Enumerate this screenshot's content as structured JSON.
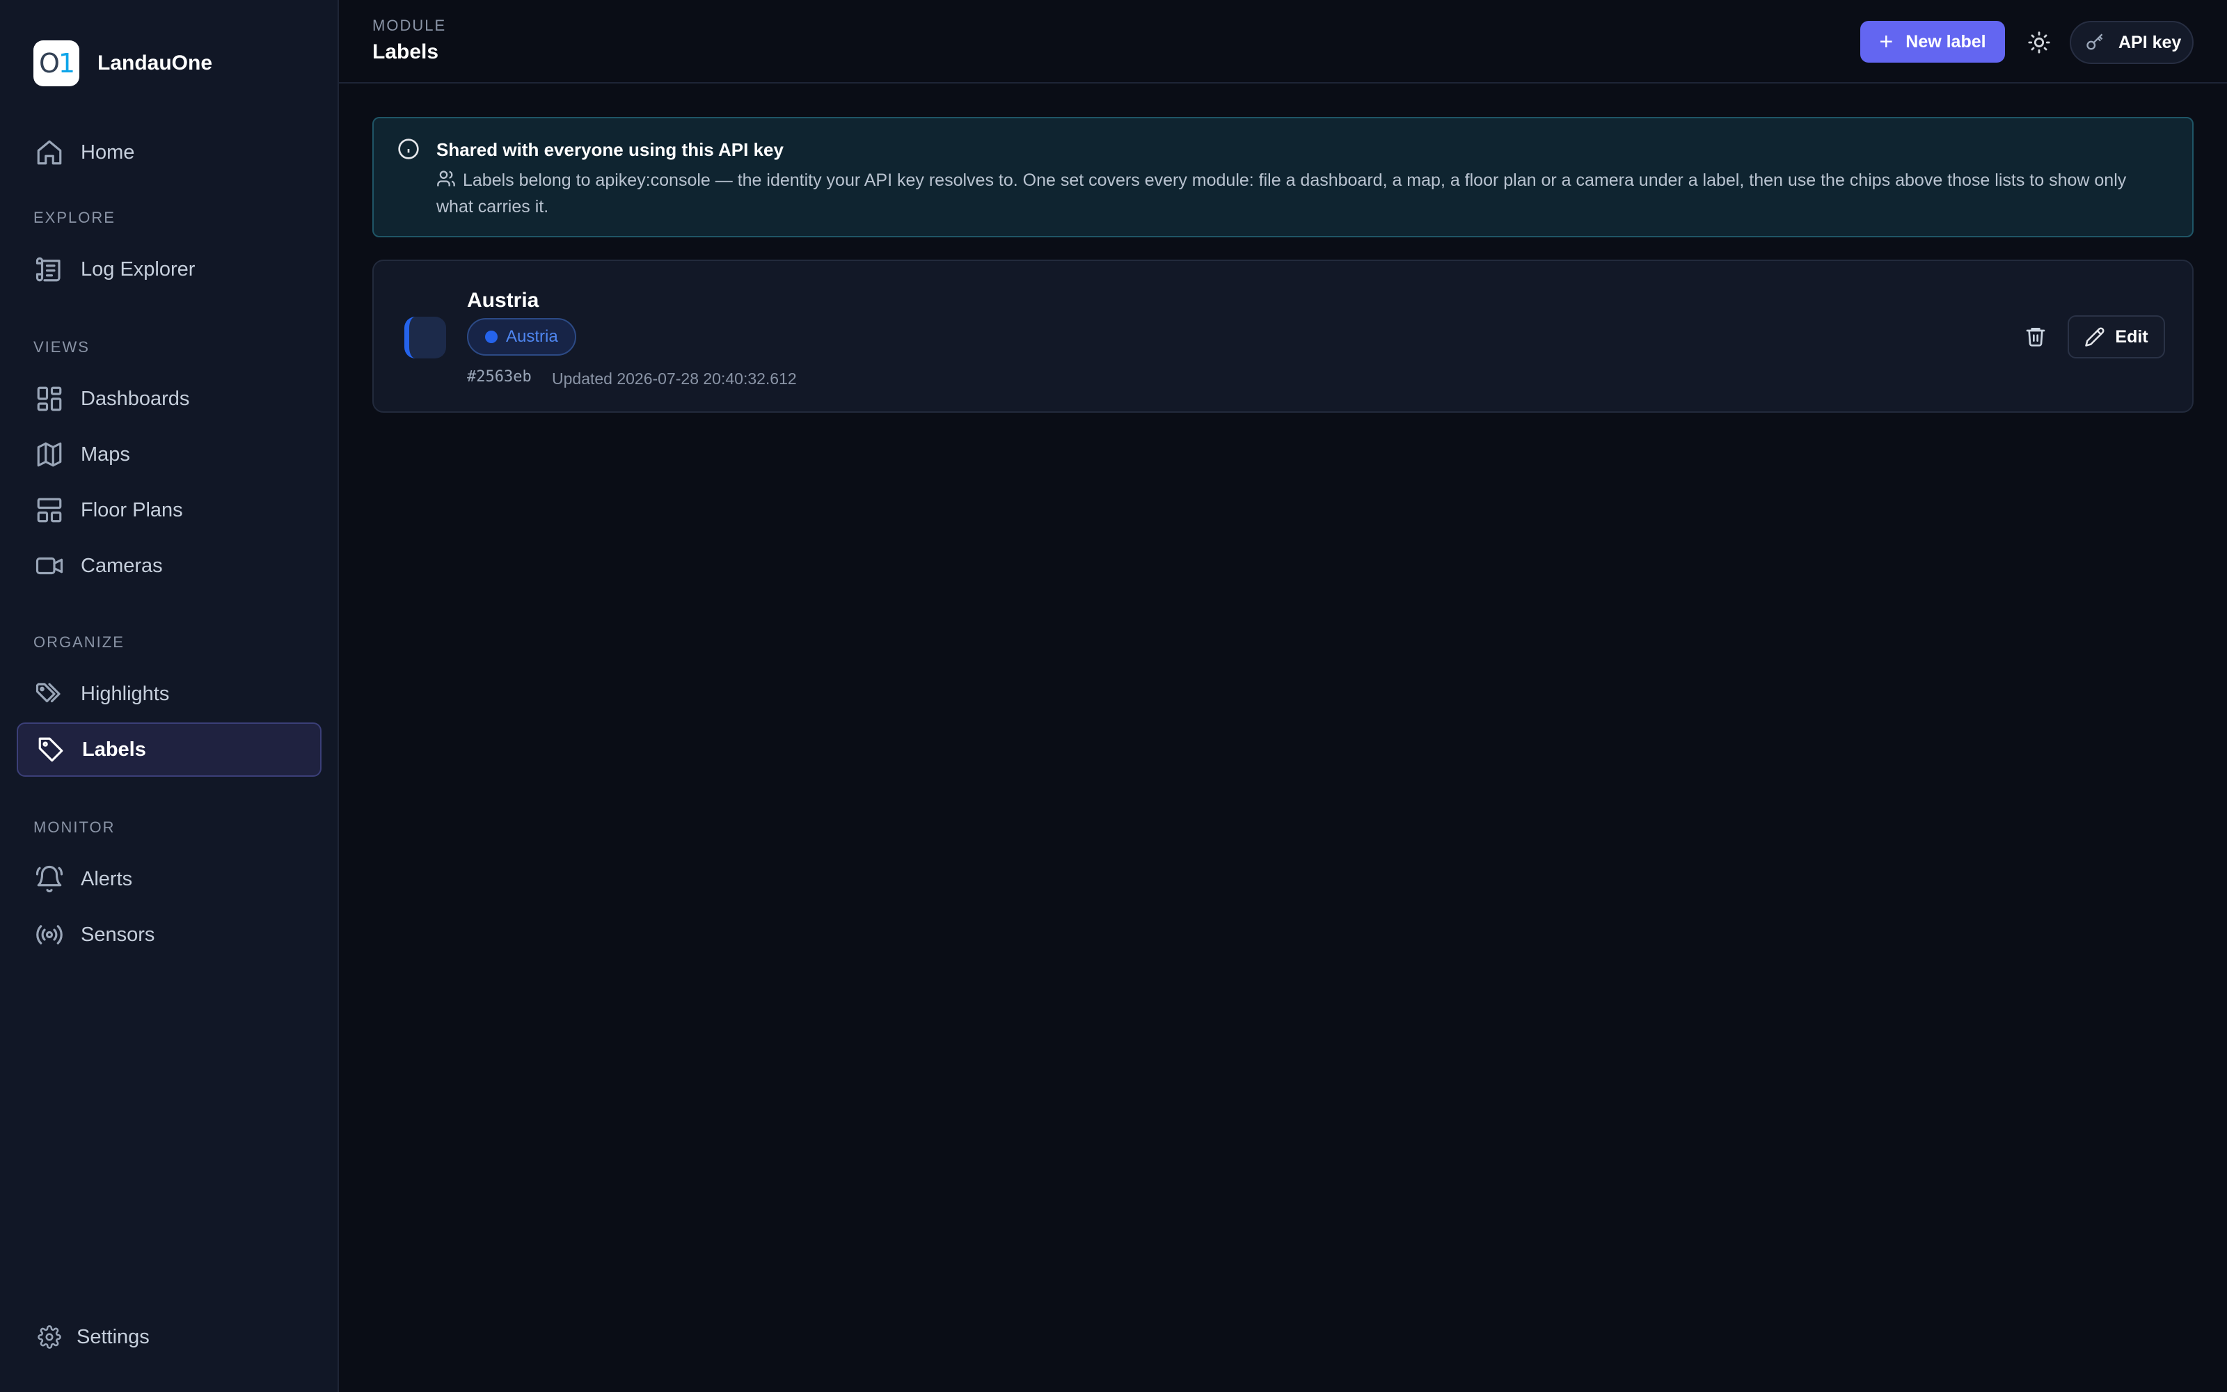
{
  "app": {
    "name": "LandauOne",
    "logo_text": "O1"
  },
  "sidebar": {
    "home": {
      "label": "Home",
      "icon": "home-icon"
    },
    "sections": {
      "explore": "EXPLORE",
      "views": "VIEWS",
      "organize": "ORGANIZE",
      "monitor": "MONITOR"
    },
    "log_explorer": {
      "label": "Log Explorer",
      "icon": "scroll-icon"
    },
    "dashboards": {
      "label": "Dashboards",
      "icon": "dashboard-icon"
    },
    "maps": {
      "label": "Maps",
      "icon": "map-icon"
    },
    "floor_plans": {
      "label": "Floor Plans",
      "icon": "floor-plan-icon"
    },
    "cameras": {
      "label": "Cameras",
      "icon": "camera-icon"
    },
    "highlights": {
      "label": "Highlights",
      "icon": "tags-icon"
    },
    "labels": {
      "label": "Labels",
      "icon": "tag-icon",
      "active": true
    },
    "alerts": {
      "label": "Alerts",
      "icon": "bell-icon"
    },
    "sensors": {
      "label": "Sensors",
      "icon": "radio-icon"
    },
    "settings": {
      "label": "Settings",
      "icon": "gear-icon"
    }
  },
  "header": {
    "module_label": "MODULE",
    "title": "Labels",
    "new_label_button": "New label",
    "api_key_button": "API key"
  },
  "banner": {
    "title": "Shared with everyone using this API key",
    "body": "Labels belong to apikey:console — the identity your API key resolves to. One set covers every module: file a dashboard, a map, a floor plan or a camera under a label, then use the chips above those lists to show only what carries it."
  },
  "labels": [
    {
      "name": "Austria",
      "chip": "Austria",
      "color": "#2563eb",
      "hex": "#2563eb",
      "updated": "Updated 2026-07-28 20:40:32.612",
      "edit_label": "Edit"
    }
  ],
  "colors": {
    "accent": "#6366f1",
    "background": "#0a0d16",
    "sidebar": "#111726",
    "label_color": "#2563eb"
  }
}
